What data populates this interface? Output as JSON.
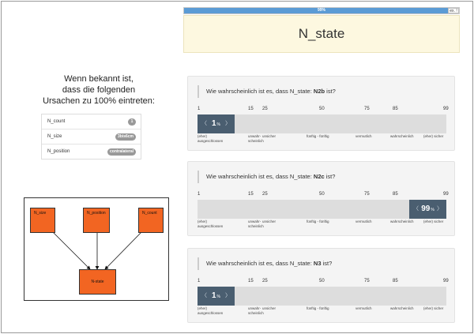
{
  "progress": {
    "text": "99%",
    "percent": 99
  },
  "exit_button": {
    "label": "ex. !"
  },
  "state": {
    "title": "N_state"
  },
  "causes": {
    "title": "Wenn bekannt ist,\ndass die folgenden\nUrsachen zu 100% eintreten:",
    "items": [
      {
        "label": "N_count",
        "badge": "1"
      },
      {
        "label": "N_size",
        "badge": "3bis6cm"
      },
      {
        "label": "N_position",
        "badge": "contralateral"
      }
    ]
  },
  "diagram": {
    "nodes": [
      "N_size",
      "N_position",
      "N_count",
      "N-state"
    ]
  },
  "questions": [
    {
      "prefix": "Wie wahrscheinlich ist es, dass N_state:",
      "target": "N2b",
      "suffix": " ist?",
      "value": "1",
      "unit": "%",
      "level": 1
    },
    {
      "prefix": "Wie wahrscheinlich ist es, dass N_state:",
      "target": "N2c",
      "suffix": " ist?",
      "value": "99",
      "unit": "%",
      "level": 99
    },
    {
      "prefix": "Wie wahrscheinlich ist es, dass N_state:",
      "target": "N3",
      "suffix": " ist?",
      "value": "1",
      "unit": "%",
      "level": 1
    }
  ],
  "scale": {
    "ticks": [
      "1",
      "15",
      "25",
      "50",
      "75",
      "85",
      "99"
    ],
    "labels": [
      "(eher) ausgeschlossen",
      "unwahr-scheinlich",
      "unsicher",
      "fünftig - fünftig",
      "vermutlich",
      "wahrscheinlich",
      "(eher) sicher"
    ]
  },
  "handle_arrows": {
    "left": "〈",
    "right": "〉"
  }
}
